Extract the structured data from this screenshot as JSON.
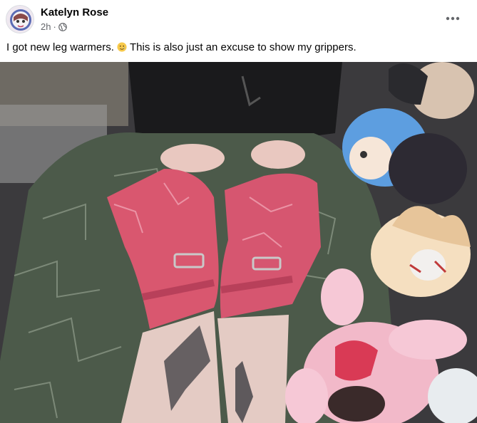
{
  "post": {
    "author_name": "Katelyn Rose",
    "timestamp": "2h",
    "meta_separator": "·",
    "privacy_icon": "globe-icon",
    "more_icon": "more-options-icon",
    "caption_part1": "I got new leg warmers.",
    "caption_emoji": "smiling-face-with-tear",
    "caption_part2": "This is also just an excuse to show my grippers.",
    "photo_subject": "pink distressed leg warmers with buckles, tattooed legs on patterned blanket with plushies"
  },
  "colors": {
    "name": "#050505",
    "meta": "#65676b",
    "leg_warmer": "#d9576f",
    "blanket": "#4c5a4a",
    "plush_blue": "#5d9ee0",
    "plush_pink": "#f2b9c9"
  }
}
